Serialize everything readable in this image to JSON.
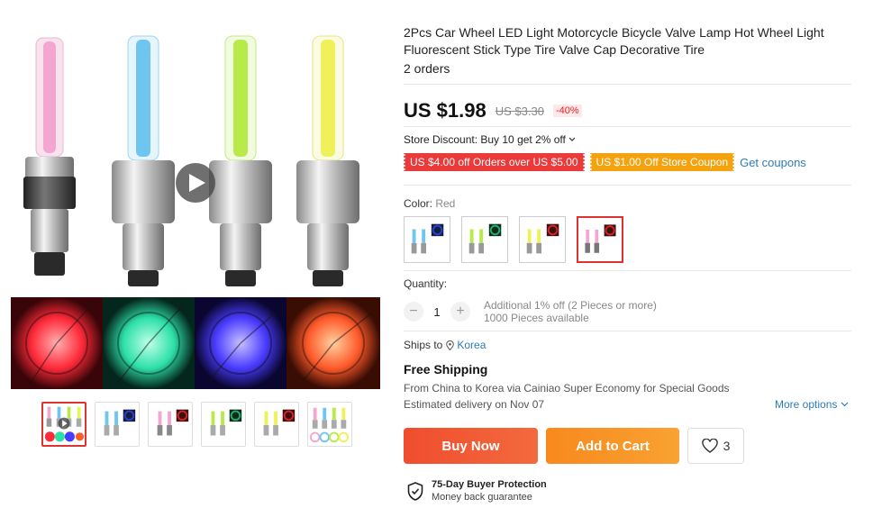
{
  "product": {
    "title": "2Pcs Car Wheel LED Light Motorcycle Bicycle Valve Lamp Hot Wheel Light Fluorescent Stick Type Tire Valve Cap Decorative Tire",
    "orders": "2 orders",
    "price": "US $1.98",
    "original_price": "US $3.30",
    "discount": "-40%"
  },
  "gallery": {
    "play_icon": "play-icon",
    "main_image_stick_colors": [
      "#f2a6d0",
      "#6ec6f0",
      "#b8ea4a",
      "#f0f05a"
    ],
    "wheel_glow_colors": [
      "#ff2a3a",
      "#2ee0a8",
      "#4a3cff",
      "#ff5a2a"
    ],
    "thumbnails": [
      {
        "label": "thumb-1",
        "selected": true
      },
      {
        "label": "thumb-2",
        "selected": false
      },
      {
        "label": "thumb-3",
        "selected": false
      },
      {
        "label": "thumb-4",
        "selected": false
      },
      {
        "label": "thumb-5",
        "selected": false
      },
      {
        "label": "thumb-6",
        "selected": false
      }
    ]
  },
  "store_discount": {
    "text": "Store Discount: Buy 10 get 2% off",
    "chevron_icon": "chevron-down-icon"
  },
  "coupons": {
    "items": [
      "US $4.00 off Orders over US $5.00",
      "US $1.00 Off Store Coupon"
    ],
    "get_label": "Get coupons",
    "colors": {
      "red": "#ea3a3a",
      "orange": "#f5a20f"
    }
  },
  "color": {
    "label": "Color: ",
    "selected": "Red",
    "options": [
      {
        "name": "Blue",
        "accent": "#2244dd",
        "selected": false
      },
      {
        "name": "Green",
        "accent": "#22b06a",
        "selected": false
      },
      {
        "name": "Yellow",
        "accent": "#dd2222",
        "selected": false
      },
      {
        "name": "Red",
        "accent": "#dd2222",
        "selected": true
      }
    ]
  },
  "quantity": {
    "label": "Quantity:",
    "value": "1",
    "minus": "−",
    "plus": "+",
    "note_line1": "Additional 1% off (2 Pieces or more)",
    "note_line2": "1000 Pieces available"
  },
  "shipping": {
    "ships_to_label": "Ships to",
    "country": "Korea",
    "pin_icon": "location-pin-icon",
    "free_shipping": "Free Shipping",
    "detail": "From China to Korea via Cainiao Super Economy for Special Goods",
    "delivery": "Estimated delivery on Nov 07",
    "more_options": "More options"
  },
  "actions": {
    "buy_now": "Buy Now",
    "add_to_cart": "Add to Cart",
    "wishlist_count": "3",
    "heart_icon": "heart-icon"
  },
  "protection": {
    "title": "75-Day Buyer Protection",
    "subtitle": "Money back guarantee",
    "shield_icon": "shield-check-icon"
  }
}
